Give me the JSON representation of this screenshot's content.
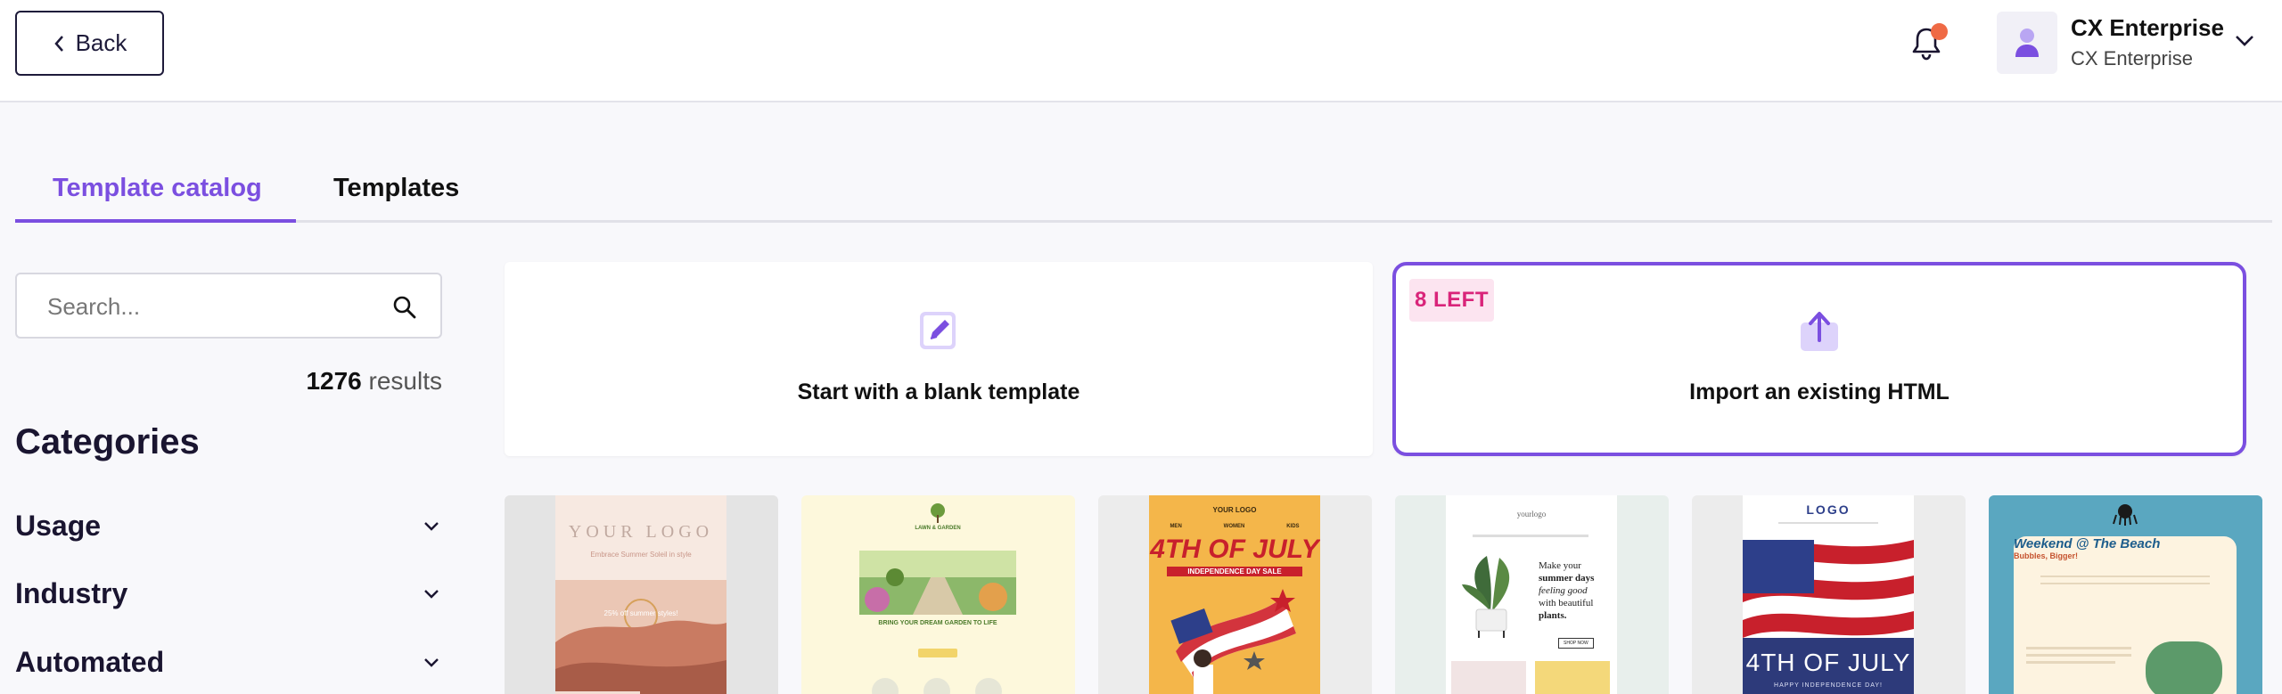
{
  "header": {
    "back_label": "Back",
    "account_name": "CX Enterprise",
    "account_sub": "CX Enterprise",
    "icons": [
      "chevron-left-icon",
      "bell-icon",
      "user-icon",
      "chevron-down-icon"
    ],
    "notification_dot_color": "#ef6a45"
  },
  "tabs": [
    {
      "label": "Template catalog",
      "active": true
    },
    {
      "label": "Templates",
      "active": false
    }
  ],
  "sidebar": {
    "search_placeholder": "Search...",
    "results_count": "1276",
    "results_label": "results",
    "categories_title": "Categories",
    "categories": [
      {
        "label": "Usage"
      },
      {
        "label": "Industry"
      },
      {
        "label": "Automated"
      }
    ]
  },
  "actions": {
    "blank_label": "Start with a blank template",
    "import_label": "Import an existing HTML",
    "import_badge": "8 LEFT"
  },
  "accent_color": "#7b4fe0",
  "templates": [
    {
      "logo": "YOUR LOGO",
      "headline": "Embrace Summer Soleil in style",
      "promo": "25% off summer styles!"
    },
    {
      "brand": "LAWN & GARDEN",
      "headline": "BRING YOUR DREAM GARDEN TO LIFE"
    },
    {
      "logo": "YOUR LOGO",
      "headline": "4TH OF JULY",
      "subhead": "INDEPENDENCE DAY SALE",
      "nav": [
        "MEN",
        "WOMEN",
        "KIDS"
      ]
    },
    {
      "logo": "yourlogo",
      "headline_a": "Make your",
      "headline_b": "summer days",
      "headline_c": "feeling good",
      "headline_d": "with beautiful",
      "headline_e": "plants.",
      "cta": "SHOP NOW"
    },
    {
      "logo": "LOGO",
      "headline": "4TH OF JULY",
      "subhead": "HAPPY INDEPENDENCE DAY!"
    },
    {
      "headline": "Weekend @ The Beach",
      "subhead": "Bubbles, Bigger!"
    }
  ]
}
